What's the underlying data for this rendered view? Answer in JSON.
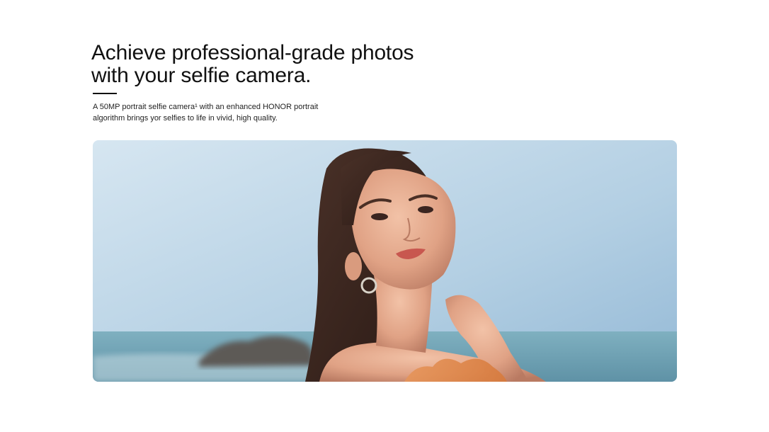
{
  "section": {
    "headline_line1": "Achieve professional-grade photos",
    "headline_line2": "with your selfie camera.",
    "description_line1": "A 50MP portrait selfie camera¹ with an enhanced HONOR portrait",
    "description_line2": "algorithm brings yor selfies to life in vivid, high quality."
  },
  "hero_image": {
    "subject": "portrait-selfie-photo",
    "colors": {
      "sky_top": "#c8dcea",
      "sky_bottom": "#9fc2dc",
      "sea": "#6d9fb2",
      "skin": "#e4a98c",
      "hair": "#3a2620",
      "dress": "#e08a4a"
    }
  }
}
